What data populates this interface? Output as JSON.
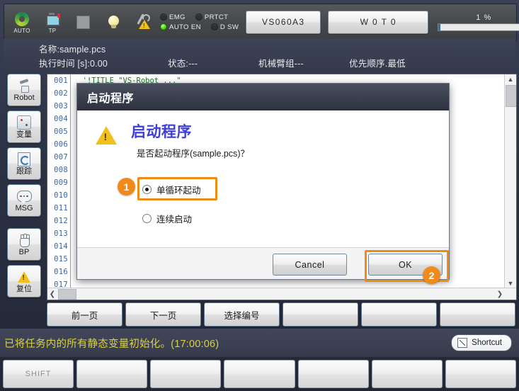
{
  "topbar": {
    "icons": [
      {
        "name": "auto-mode-icon",
        "label": "AUTO"
      },
      {
        "name": "teach-pendant-icon",
        "label": "TP"
      },
      {
        "name": "stop-square-icon",
        "label": ""
      },
      {
        "name": "lamp-icon",
        "label": ""
      },
      {
        "name": "maintenance-warning-icon",
        "label": ""
      }
    ],
    "leds": [
      {
        "label": "EMG",
        "on": false
      },
      {
        "label": "PRTCT",
        "on": false
      },
      {
        "label": "AUTO EN",
        "on": true
      },
      {
        "label": "D SW",
        "on": false
      }
    ],
    "robot_model_button": "VS060A3",
    "tool_button": "W 0 T 0",
    "speed_percent_label": "1 %",
    "speed_percent_value": 1
  },
  "program_info": {
    "name_label": "名称:sample.pcs",
    "exec_time_label": "执行时间 [s]:0.00",
    "status_label": "状态:---",
    "arm_group_label": "机械臂组---",
    "priority_label": "优先顺序.最低"
  },
  "sidebar": {
    "items": [
      {
        "label": "Robot",
        "icon": "robot-arm-icon"
      },
      {
        "label": "变量",
        "icon": "variable-cube-icon"
      },
      {
        "label": "跟踪",
        "icon": "trace-page-icon"
      },
      {
        "label": "MSG",
        "icon": "message-bubble-icon"
      },
      {
        "label": "BP",
        "icon": "hand-breakpoint-icon"
      },
      {
        "label": "复位",
        "icon": "warning-triangle-icon"
      }
    ]
  },
  "editor": {
    "line_numbers": [
      "001",
      "002",
      "003",
      "004",
      "005",
      "006",
      "007",
      "008",
      "009",
      "010",
      "011",
      "012",
      "013",
      "014",
      "015",
      "016",
      "017"
    ],
    "code_lines": [
      "  '!TITLE \"VS-Robot ...\"",
      "",
      "",
      "",
      "",
      "",
      "",
      "",
      "",
      "",
      "",
      "",
      "",
      "",
      "",
      "",
      ""
    ]
  },
  "dialog": {
    "title": "启动程序",
    "heading": "启动程序",
    "question": "是否起动程序(sample.pcs)？",
    "options": [
      {
        "label": "单循环起动",
        "selected": true
      },
      {
        "label": "连续启动",
        "selected": false
      }
    ],
    "cancel_button": "Cancel",
    "ok_button": "OK",
    "callouts": [
      {
        "number": "1",
        "target": "single-cycle-radio"
      },
      {
        "number": "2",
        "target": "ok-button"
      }
    ],
    "highlight_color": "#ef8c15",
    "heading_color": "#3d3fd6"
  },
  "function_buttons": [
    {
      "label": "前一页"
    },
    {
      "label": "下一页"
    },
    {
      "label": "选择编号"
    },
    {
      "label": ""
    },
    {
      "label": ""
    },
    {
      "label": ""
    }
  ],
  "status_bar": {
    "message": "已将任务内的所有静态变量初始化。(17:00:06)",
    "message_color": "#d9d146",
    "shortcut_label": "Shortcut"
  },
  "key_row": [
    {
      "label": "SHIFT"
    },
    {
      "label": ""
    },
    {
      "label": ""
    },
    {
      "label": ""
    },
    {
      "label": ""
    },
    {
      "label": ""
    },
    {
      "label": ""
    }
  ]
}
